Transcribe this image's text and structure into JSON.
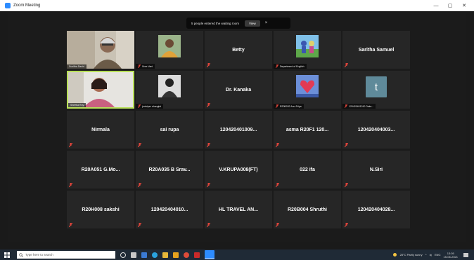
{
  "window": {
    "title": "Zoom Meeting",
    "controls": [
      "—",
      "▢",
      "✕"
    ]
  },
  "notification": {
    "text": "5 people entered the waiting room",
    "view_label": "View",
    "close_label": "×"
  },
  "colors": {
    "speaking_border": "#b9e05a",
    "mute_icon": "#e0453b",
    "tile_bg": "#262626",
    "zoom_blue": "#2d8cff"
  },
  "participants": [
    {
      "name": "Sunitha David",
      "type": "video"
    },
    {
      "name": "Sree Vani",
      "type": "picture"
    },
    {
      "name": "Betty",
      "type": "name"
    },
    {
      "name": "Department of English",
      "type": "picture"
    },
    {
      "name": "Saritha Samuel",
      "type": "name"
    },
    {
      "name": "Sheeba Roy",
      "type": "video",
      "speaking": true
    },
    {
      "name": "jeniviper shanglai",
      "type": "picture"
    },
    {
      "name": "Dr. Kanaka",
      "type": "name"
    },
    {
      "name": "R20B032 Anu Priya",
      "type": "picture"
    },
    {
      "name": "120420401010 Daks...",
      "type": "letter",
      "letter": "t"
    },
    {
      "name": "Nirmala",
      "type": "name"
    },
    {
      "name": "sai rupa",
      "type": "name"
    },
    {
      "name": "120420401009...",
      "type": "name"
    },
    {
      "name": "asma R20F1 120...",
      "type": "name"
    },
    {
      "name": "120420404003...",
      "type": "name"
    },
    {
      "name": "R20A051 G.Mo...",
      "type": "name"
    },
    {
      "name": "R20A035 B Srav...",
      "type": "name"
    },
    {
      "name": "V.KRUPA008(FT)",
      "type": "name"
    },
    {
      "name": "022 ifa",
      "type": "name"
    },
    {
      "name": "N.Siri",
      "type": "name"
    },
    {
      "name": "R20H008 sakshi",
      "type": "name"
    },
    {
      "name": "120420404010...",
      "type": "name"
    },
    {
      "name": "HL TRAVEL AN...",
      "type": "name"
    },
    {
      "name": "R20B004 Shruthi",
      "type": "name"
    },
    {
      "name": "120420404028...",
      "type": "name"
    }
  ],
  "taskbar": {
    "search_placeholder": "Type here to search",
    "weather": "28°C Partly sunny",
    "language": "ENG",
    "time": "13:05",
    "date": "15-06-2021"
  }
}
